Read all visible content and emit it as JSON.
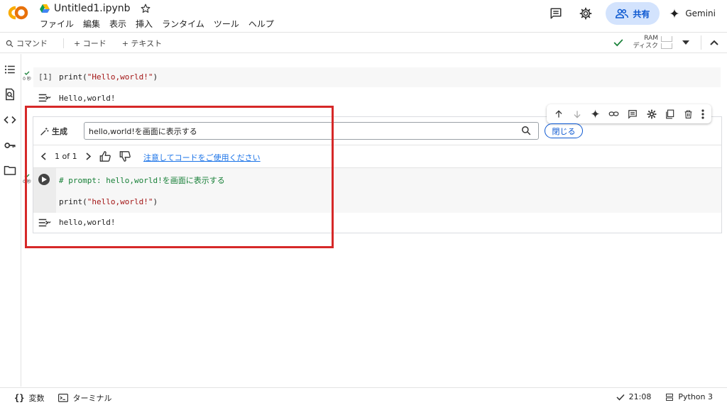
{
  "header": {
    "notebook_title": "Untitled1.ipynb",
    "menu": [
      "ファイル",
      "編集",
      "表示",
      "挿入",
      "ランタイム",
      "ツール",
      "ヘルプ"
    ],
    "share_label": "共有",
    "gemini_label": "Gemini"
  },
  "toolbar": {
    "command_label": "コマンド",
    "add_code_label": "+ コード",
    "add_text_label": "+ テキスト",
    "ram_label": "RAM",
    "disk_label": "ディスク"
  },
  "cell1": {
    "exec_count": "[1]",
    "elapsed": "0 秒",
    "code_fn": "print(",
    "code_str": "\"Hello,world!\"",
    "code_end": ")",
    "output": "Hello,world!"
  },
  "generate": {
    "label": "生成",
    "prompt_value": "hello,world!を画面に表示する",
    "close_label": "閉じる",
    "pager_text": "1 of 1",
    "notice_link": "注意してコードをご使用ください"
  },
  "cell2": {
    "elapsed": "0 秒",
    "comment_line": "# prompt: hello,world!を画面に表示する",
    "code_fn": "print(",
    "code_str": "\"hello,world!\"",
    "code_end": ")",
    "output": "hello,world!"
  },
  "statusbar": {
    "variables_label": "変数",
    "terminal_label": "ターミナル",
    "time": "21:08",
    "runtime": "Python 3"
  },
  "colors": {
    "accent": "#0b57d0",
    "share_bg": "#d3e3fd",
    "logo_orange": "#f9ab00",
    "logo_dark_orange": "#e8710a",
    "success": "#188038",
    "annotation_red": "#d62828"
  }
}
